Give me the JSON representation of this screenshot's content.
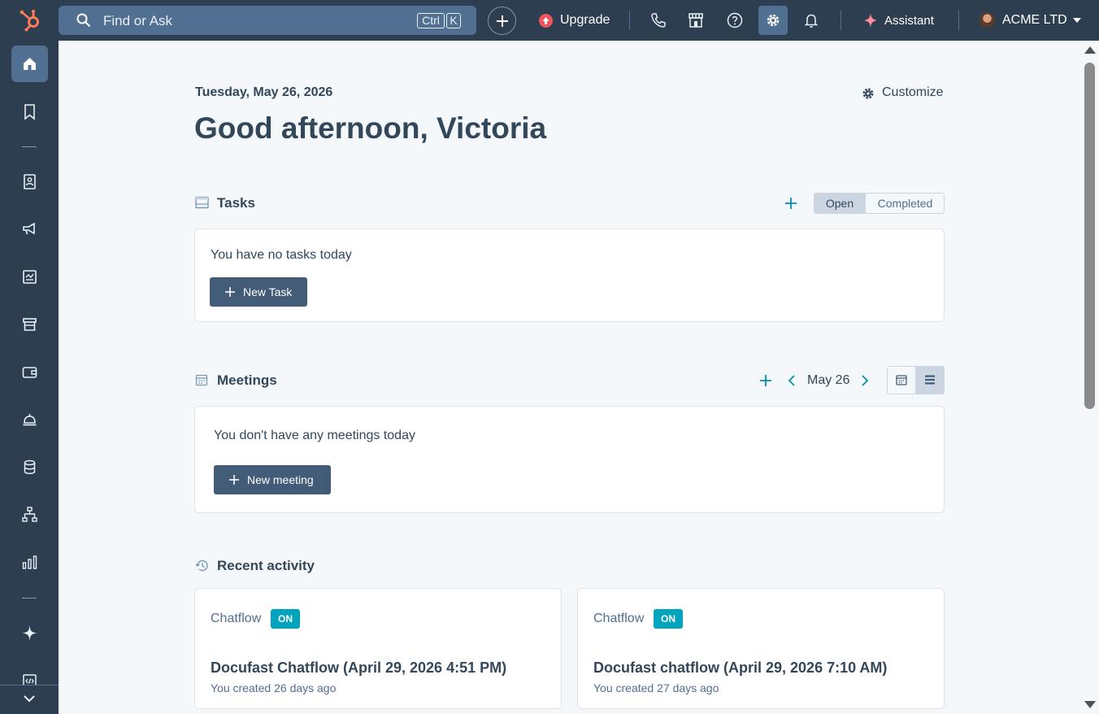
{
  "topbar": {
    "search_placeholder": "Find or Ask",
    "shortcut_ctrl": "Ctrl",
    "shortcut_k": "K",
    "upgrade_label": "Upgrade",
    "assistant_label": "Assistant",
    "account_name": "ACME LTD",
    "icons": [
      "hubspot-logo",
      "search-icon",
      "plus-icon",
      "upgrade-icon",
      "phone-icon",
      "marketplace-icon",
      "help-icon",
      "settings-icon",
      "bell-icon",
      "sparkle-icon",
      "avatar",
      "caret-down-icon"
    ]
  },
  "sidebar": {
    "items": [
      "home-icon",
      "bookmark-icon",
      "contacts-icon",
      "marketing-icon",
      "content-icon",
      "commerce-icon",
      "sales-icon",
      "service-icon",
      "data-icon",
      "automation-icon",
      "reporting-icon",
      "breeze-icon",
      "development-icon",
      "expand-icon"
    ]
  },
  "main": {
    "date": "Tuesday, May 26, 2026",
    "greeting": "Good afternoon, Victoria",
    "customize_label": "Customize",
    "tasks": {
      "title": "Tasks",
      "tab_open": "Open",
      "tab_completed": "Completed",
      "empty_message": "You have no tasks today",
      "new_button": "New Task"
    },
    "meetings": {
      "title": "Meetings",
      "current_date": "May 26",
      "empty_message": "You don't have any meetings today",
      "new_button": "New meeting"
    },
    "recent_activity": {
      "title": "Recent activity",
      "items": [
        {
          "type": "Chatflow",
          "status": "ON",
          "title": "Docufast Chatflow (April 29, 2026 4:51 PM)",
          "meta": "You created 26 days ago"
        },
        {
          "type": "Chatflow",
          "status": "ON",
          "title": "Docufast chatflow (April 29, 2026 7:10 AM)",
          "meta": "You created 27 days ago"
        }
      ]
    }
  },
  "colors": {
    "nav_bg": "#2d3e50",
    "accent_teal": "#00a4bd",
    "button_dark": "#425b76",
    "brand_orange": "#ff7a59",
    "page_bg": "#f5f8fa"
  }
}
